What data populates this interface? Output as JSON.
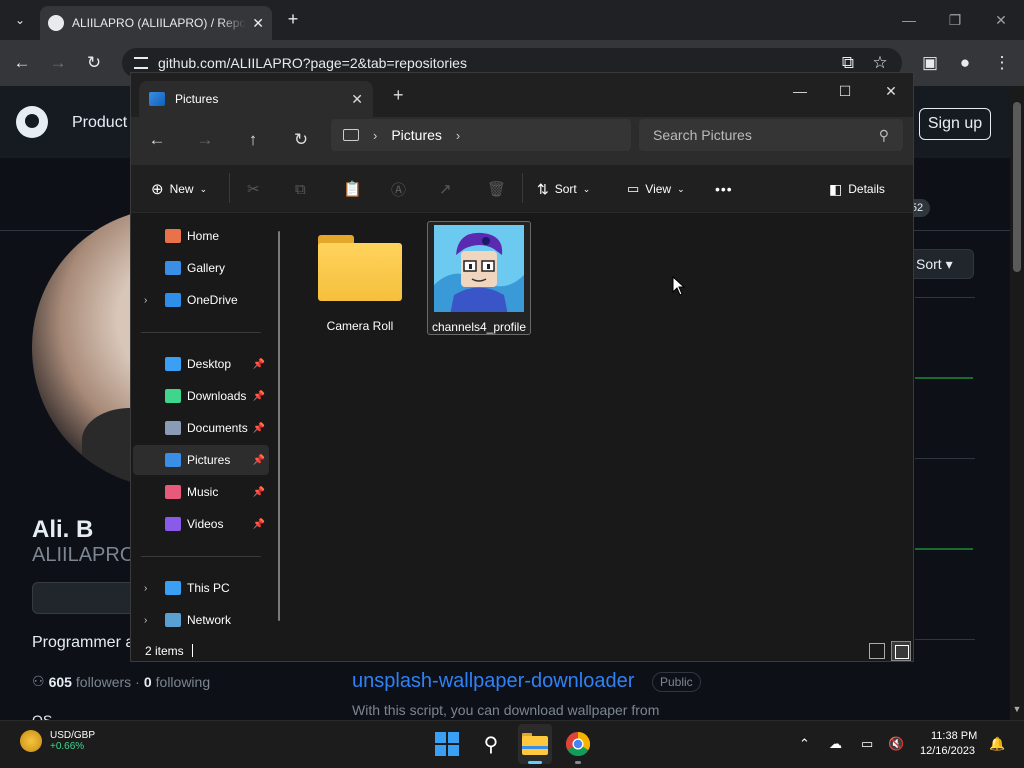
{
  "browser": {
    "tab_title": "ALIILAPRO (ALIILAPRO) / Repositories",
    "close_tab": "✕",
    "new_tab": "+",
    "url": "github.com/ALIILAPRO?page=2&tab=repositories",
    "controls": {
      "minimize": "—",
      "maximize": "❐",
      "close": "✕"
    },
    "icons": [
      "tab-search-icon",
      "back-icon",
      "forward-icon",
      "reload-icon",
      "install-app-icon",
      "bookmark-star-icon",
      "side-panel-icon",
      "profile-icon",
      "menu-icon"
    ]
  },
  "github": {
    "nav_product": "Product",
    "signup_label": "Sign up",
    "repo_count": "52",
    "name": "Ali. B",
    "username": "ALIILAPRO",
    "bio": "Programmer a",
    "followers_count": "605",
    "followers_label": "followers",
    "following_count": "0",
    "following_label": "following",
    "os_text": "OS",
    "sort_label": "Sort",
    "repo_name": "unsplash-wallpaper-downloader",
    "repo_visibility": "Public",
    "repo_description": "With this script, you can download wallpaper from"
  },
  "explorer": {
    "tab_title": "Pictures",
    "new_tab": "+",
    "address": {
      "root_icon": "this-pc-icon",
      "segment": "Pictures"
    },
    "search_placeholder": "Search Pictures",
    "commands": {
      "new": "New",
      "sort": "Sort",
      "view": "View",
      "more": "•••",
      "details": "Details"
    },
    "sidebar": {
      "quick": [
        {
          "label": "Home",
          "icon": "home-icon",
          "color": "#e8734a"
        },
        {
          "label": "Gallery",
          "icon": "gallery-icon",
          "color": "#3a8ee6"
        },
        {
          "label": "OneDrive",
          "icon": "onedrive-icon",
          "color": "#2f8fe8"
        }
      ],
      "pinned": [
        {
          "label": "Desktop",
          "icon": "desktop-icon",
          "color": "#3aa0f3"
        },
        {
          "label": "Downloads",
          "icon": "downloads-icon",
          "color": "#3dd68c"
        },
        {
          "label": "Documents",
          "icon": "documents-icon",
          "color": "#8a9bb5"
        },
        {
          "label": "Pictures",
          "icon": "pictures-icon",
          "color": "#3a8ee6"
        },
        {
          "label": "Music",
          "icon": "music-icon",
          "color": "#e85a7a"
        },
        {
          "label": "Videos",
          "icon": "videos-icon",
          "color": "#8a5ae8"
        }
      ],
      "drives": [
        {
          "label": "This PC",
          "icon": "this-pc-icon",
          "color": "#3aa0f3"
        },
        {
          "label": "Network",
          "icon": "network-icon",
          "color": "#5aa0d0"
        }
      ]
    },
    "items": [
      {
        "name": "Camera Roll",
        "type": "folder"
      },
      {
        "name": "channels4_profile",
        "type": "image"
      }
    ],
    "status": "2 items"
  },
  "taskbar": {
    "widget_title": "USD/GBP",
    "widget_change": "+0.66%",
    "time": "11:38 PM",
    "date": "12/16/2023",
    "apps": [
      "start-icon",
      "search-icon",
      "file-explorer-icon",
      "chrome-icon"
    ]
  }
}
